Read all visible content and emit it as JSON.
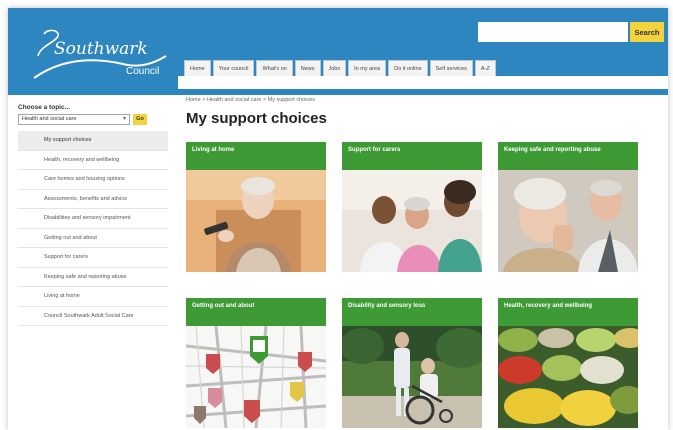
{
  "header": {
    "logo_script": "Southwark",
    "logo_council": "Council",
    "search_placeholder": "",
    "search_label": "Search",
    "nav_tabs": [
      "Home",
      "Your council",
      "What's on",
      "News",
      "Jobs",
      "In my area",
      "Do it online",
      "Self services",
      "A-Z"
    ]
  },
  "sidebar": {
    "heading": "Choose a topic...",
    "selected_topic": "Health and social care",
    "go_label": "Go",
    "items": [
      "My support choices",
      "Health, recovery and wellbeing",
      "Care homes and housing options",
      "Assessments, benefits and advice",
      "Disabilities and sensory impairment",
      "Getting out and about",
      "Support for carers",
      "Keeping safe and reporting abuse",
      "Living at home",
      "Council Southwark Adult Social Care"
    ]
  },
  "breadcrumb": "Home  >  Health and social care  >  My support choices",
  "page_title": "My support choices",
  "cards": [
    {
      "title": "Living at home",
      "image": "elderly-woman-with-remote-photo"
    },
    {
      "title": "Support for carers",
      "image": "carer-and-couple-photo"
    },
    {
      "title": "Keeping safe and reporting abuse",
      "image": "elderly-couple-photo"
    },
    {
      "title": "Getting out and about",
      "image": "street-map-with-pins"
    },
    {
      "title": "Disability and sensory loss",
      "image": "carer-pushing-wheelchair-photo"
    },
    {
      "title": "Health, recovery and wellbeing",
      "image": "healthy-food-bowls-photo"
    }
  ],
  "colors": {
    "header_blue": "#2e86c1",
    "card_green": "#3d9a35",
    "search_yellow": "#f2d33b"
  }
}
